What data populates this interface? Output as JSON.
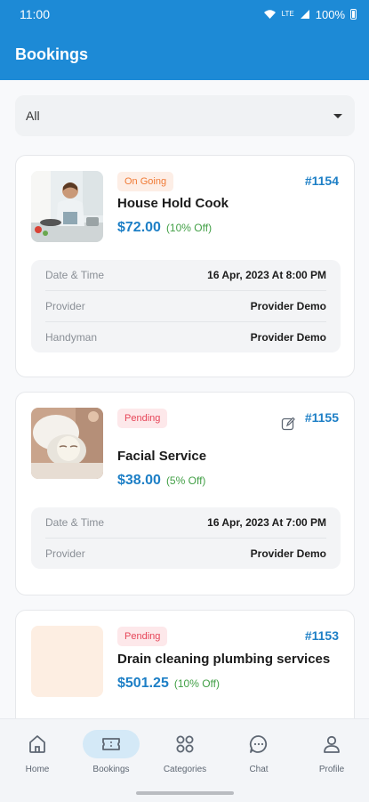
{
  "status_bar": {
    "time": "11:00",
    "network": "LTE",
    "battery": "100%"
  },
  "appbar": {
    "title": "Bookings"
  },
  "filter": {
    "selected": "All"
  },
  "bookings": [
    {
      "status": "On Going",
      "id": "#1154",
      "service": "House Hold Cook",
      "price": "$72.00",
      "discount": "(10% Off)",
      "details": [
        {
          "label": "Date & Time",
          "value": "16 Apr, 2023 At 8:00 PM"
        },
        {
          "label": "Provider",
          "value": "Provider Demo"
        },
        {
          "label": "Handyman",
          "value": "Provider Demo"
        }
      ]
    },
    {
      "status": "Pending",
      "id": "#1155",
      "service": "Facial Service",
      "price": "$38.00",
      "discount": "(5% Off)",
      "details": [
        {
          "label": "Date & Time",
          "value": "16 Apr, 2023 At 7:00 PM"
        },
        {
          "label": "Provider",
          "value": "Provider Demo"
        }
      ]
    },
    {
      "status": "Pending",
      "id": "#1153",
      "service": "Drain cleaning plumbing services",
      "price": "$501.25",
      "discount": "(10% Off)"
    }
  ],
  "nav": {
    "home": "Home",
    "bookings": "Bookings",
    "categories": "Categories",
    "chat": "Chat",
    "profile": "Profile",
    "active": "bookings"
  },
  "colors": {
    "primary": "#1d8ad6",
    "price": "#1d7fc6",
    "discount": "#43a047",
    "ongoing": "#f07a35",
    "pending": "#e64558"
  }
}
